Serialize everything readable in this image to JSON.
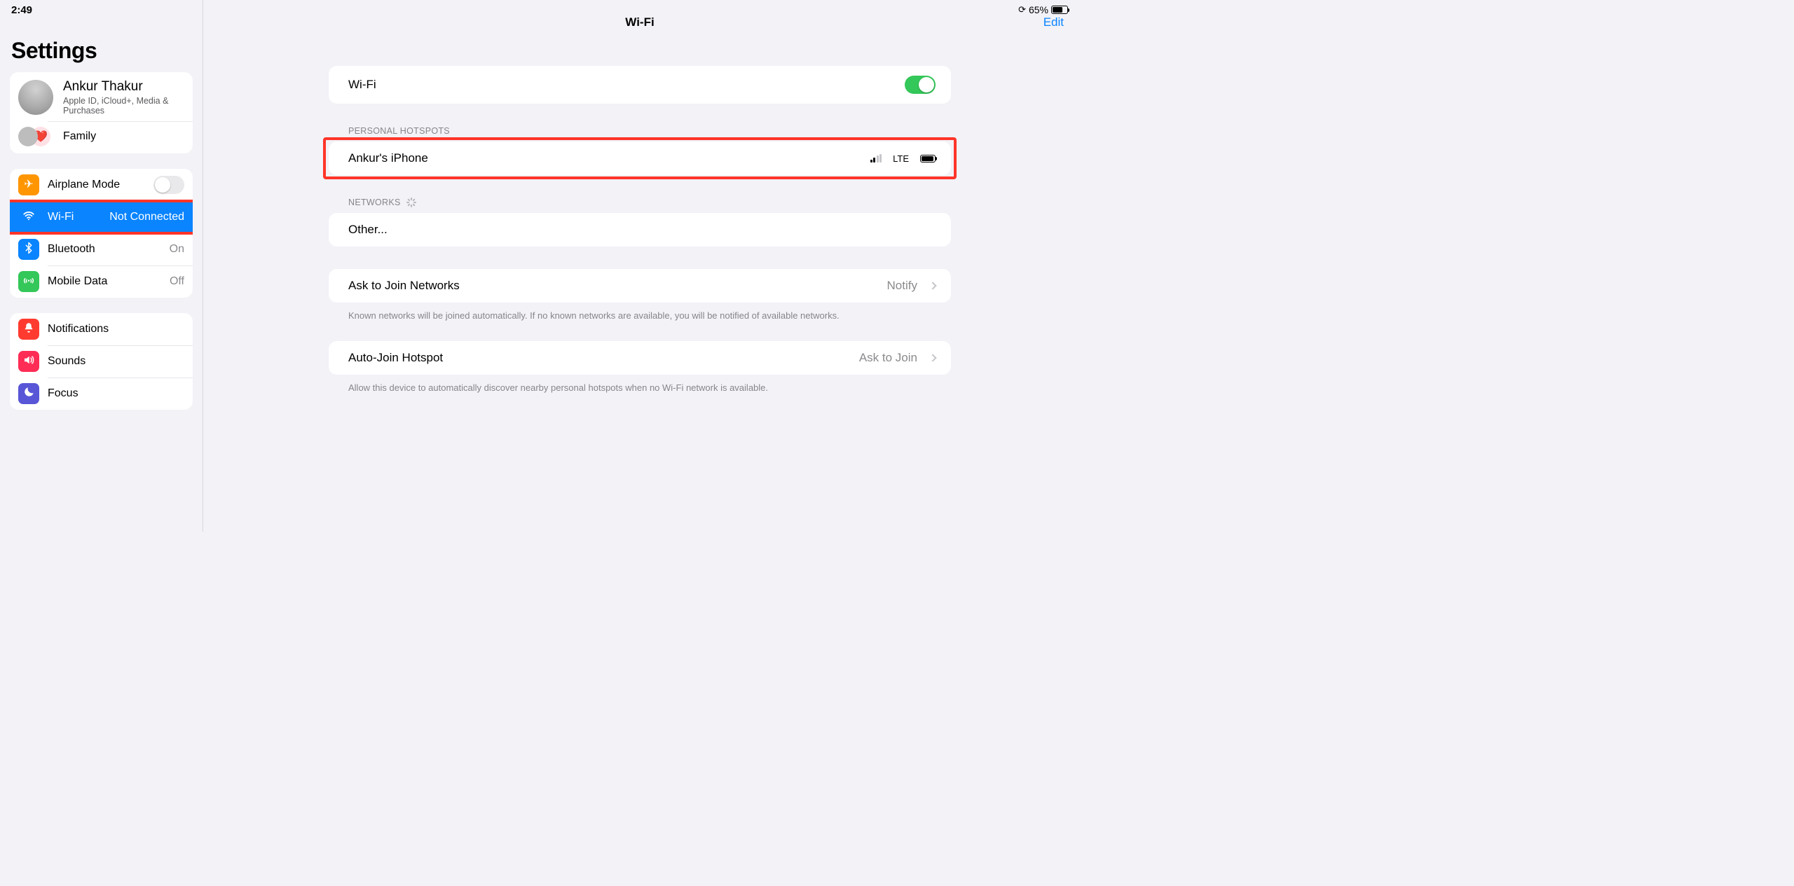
{
  "status": {
    "time": "2:49",
    "battery_percent": "65%",
    "battery_fill_pct": 65
  },
  "sidebar": {
    "title": "Settings",
    "account": {
      "name": "Ankur Thakur",
      "subtitle": "Apple ID, iCloud+, Media & Purchases"
    },
    "family_label": "Family",
    "items": {
      "airplane": {
        "label": "Airplane Mode",
        "value": ""
      },
      "wifi": {
        "label": "Wi-Fi",
        "value": "Not Connected"
      },
      "bluetooth": {
        "label": "Bluetooth",
        "value": "On"
      },
      "mobiledata": {
        "label": "Mobile Data",
        "value": "Off"
      },
      "notifications": {
        "label": "Notifications"
      },
      "sounds": {
        "label": "Sounds"
      },
      "focus": {
        "label": "Focus"
      }
    }
  },
  "detail": {
    "title": "Wi-Fi",
    "edit_label": "Edit",
    "wifi_toggle_label": "Wi-Fi",
    "wifi_toggle_on": true,
    "section_hotspots": "PERSONAL HOTSPOTS",
    "hotspot": {
      "name": "Ankur's iPhone",
      "signal_bars_on": 2,
      "net": "LTE"
    },
    "section_networks": "NETWORKS",
    "other_label": "Other...",
    "ask_join": {
      "label": "Ask to Join Networks",
      "value": "Notify"
    },
    "ask_join_note": "Known networks will be joined automatically. If no known networks are available, you will be notified of available networks.",
    "auto_join": {
      "label": "Auto-Join Hotspot",
      "value": "Ask to Join"
    },
    "auto_join_note": "Allow this device to automatically discover nearby personal hotspots when no Wi-Fi network is available."
  }
}
